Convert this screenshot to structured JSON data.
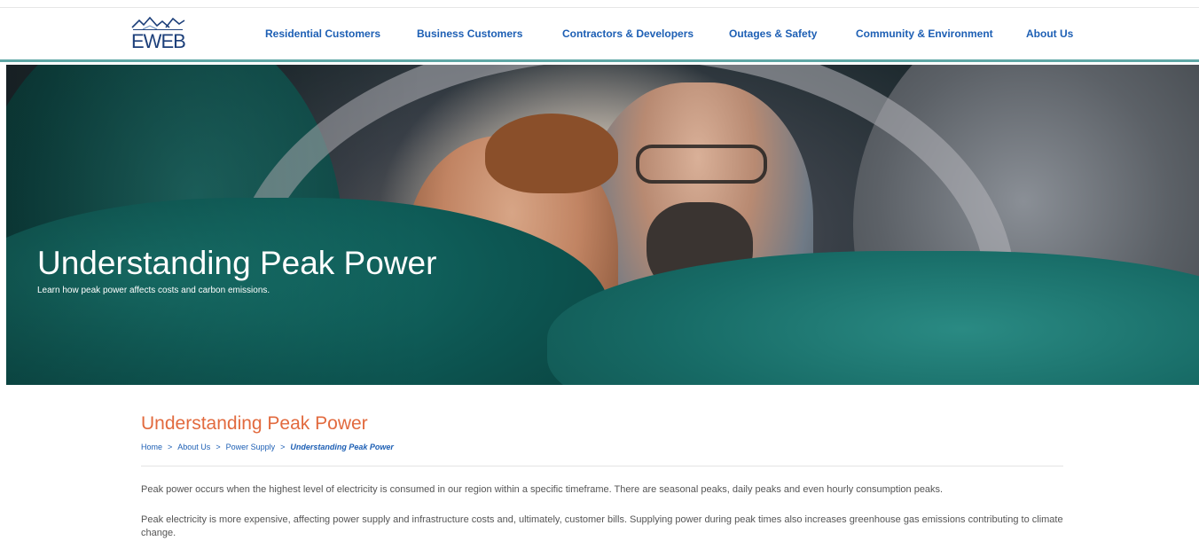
{
  "header": {
    "logo_text": "EWEB",
    "nav": [
      {
        "label": "Residential Customers"
      },
      {
        "label": "Business Customers"
      },
      {
        "label": "Contractors & Developers"
      },
      {
        "label": "Outages & Safety"
      },
      {
        "label": "Community & Environment"
      },
      {
        "label": "About Us"
      }
    ]
  },
  "hero": {
    "title": "Understanding Peak Power",
    "subtitle": "Learn how peak power affects costs and carbon emissions."
  },
  "main": {
    "page_title": "Understanding Peak Power",
    "breadcrumb": {
      "home": "Home",
      "about": "About Us",
      "power_supply": "Power Supply",
      "current": "Understanding Peak Power",
      "separator": ">"
    },
    "paragraphs": [
      "Peak power occurs when the highest level of electricity is consumed in our region within a specific timeframe. There are seasonal peaks, daily peaks and even hourly consumption peaks.",
      "Peak electricity is more expensive, affecting power supply and infrastructure costs and, ultimately, customer bills. Supplying power during peak times also increases greenhouse gas emissions contributing to climate change."
    ]
  },
  "colors": {
    "nav_link": "#1d5fb4",
    "page_title": "#e26a3e",
    "header_border": "#5fa7a5",
    "logo": "#1c3f7a"
  }
}
